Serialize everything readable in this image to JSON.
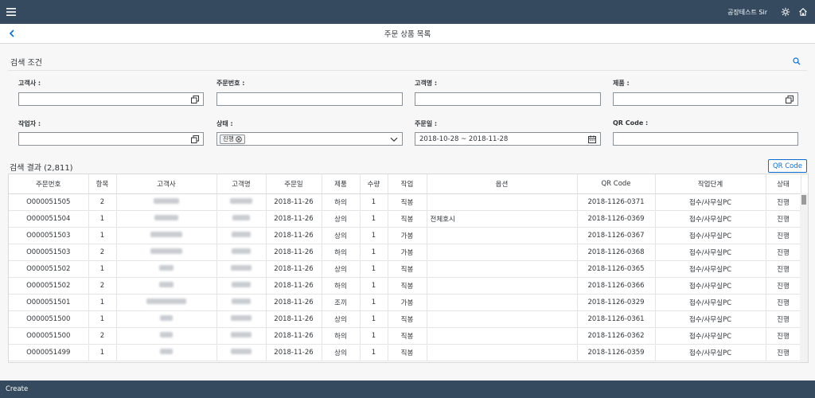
{
  "shell": {
    "user_name": "공장테스트 Sir"
  },
  "page": {
    "title": "주문 상품 목록"
  },
  "filter": {
    "section_title": "검색 조건",
    "fields": {
      "customer_company": {
        "label": "고객사 :",
        "value": ""
      },
      "order_number": {
        "label": "주문번호 :",
        "value": ""
      },
      "customer_name": {
        "label": "고객명 :",
        "value": ""
      },
      "product": {
        "label": "제품 :",
        "value": ""
      },
      "worker": {
        "label": "작업자 :",
        "value": ""
      },
      "status": {
        "label": "상태 :",
        "token": "진행"
      },
      "order_date": {
        "label": "주문일 :",
        "value": "2018-10-28 ~ 2018-11-28"
      },
      "qr_code": {
        "label": "QR Code :",
        "value": ""
      }
    }
  },
  "results": {
    "title": "검색 결과 (2,811)",
    "qr_button": "QR Code",
    "columns": [
      "주문번호",
      "항목",
      "고객사",
      "고객명",
      "주문일",
      "제품",
      "수량",
      "작업",
      "옵션",
      "QR Code",
      "작업단계",
      "상태"
    ],
    "rows": [
      {
        "order_no": "O000051505",
        "item": "2",
        "date": "2018-11-26",
        "product": "하의",
        "qty": "1",
        "work": "직봉",
        "option": "",
        "qr": "2018-1126-0371",
        "stage": "접수/사무실PC",
        "status": "진행"
      },
      {
        "order_no": "O000051504",
        "item": "1",
        "date": "2018-11-26",
        "product": "상의",
        "qty": "1",
        "work": "직봉",
        "option": "전체호시",
        "qr": "2018-1126-0369",
        "stage": "접수/사무실PC",
        "status": "진행"
      },
      {
        "order_no": "O000051503",
        "item": "1",
        "date": "2018-11-26",
        "product": "상의",
        "qty": "1",
        "work": "가봉",
        "option": "",
        "qr": "2018-1126-0367",
        "stage": "접수/사무실PC",
        "status": "진행"
      },
      {
        "order_no": "O000051503",
        "item": "2",
        "date": "2018-11-26",
        "product": "하의",
        "qty": "1",
        "work": "가봉",
        "option": "",
        "qr": "2018-1126-0368",
        "stage": "접수/사무실PC",
        "status": "진행"
      },
      {
        "order_no": "O000051502",
        "item": "1",
        "date": "2018-11-26",
        "product": "상의",
        "qty": "1",
        "work": "직봉",
        "option": "",
        "qr": "2018-1126-0365",
        "stage": "접수/사무실PC",
        "status": "진행"
      },
      {
        "order_no": "O000051502",
        "item": "2",
        "date": "2018-11-26",
        "product": "하의",
        "qty": "1",
        "work": "직봉",
        "option": "",
        "qr": "2018-1126-0366",
        "stage": "접수/사무실PC",
        "status": "진행"
      },
      {
        "order_no": "O000051501",
        "item": "1",
        "date": "2018-11-26",
        "product": "조끼",
        "qty": "1",
        "work": "가봉",
        "option": "",
        "qr": "2018-1126-0329",
        "stage": "접수/사무실PC",
        "status": "진행"
      },
      {
        "order_no": "O000051500",
        "item": "1",
        "date": "2018-11-26",
        "product": "상의",
        "qty": "1",
        "work": "직봉",
        "option": "",
        "qr": "2018-1126-0361",
        "stage": "접수/사무실PC",
        "status": "진행"
      },
      {
        "order_no": "O000051500",
        "item": "2",
        "date": "2018-11-26",
        "product": "하의",
        "qty": "1",
        "work": "직봉",
        "option": "",
        "qr": "2018-1126-0362",
        "stage": "접수/사무실PC",
        "status": "진행"
      },
      {
        "order_no": "O000051499",
        "item": "1",
        "date": "2018-11-26",
        "product": "상의",
        "qty": "1",
        "work": "직봉",
        "option": "",
        "qr": "2018-1126-0359",
        "stage": "접수/사무실PC",
        "status": "진행"
      }
    ]
  },
  "footer": {
    "create_label": "Create"
  }
}
